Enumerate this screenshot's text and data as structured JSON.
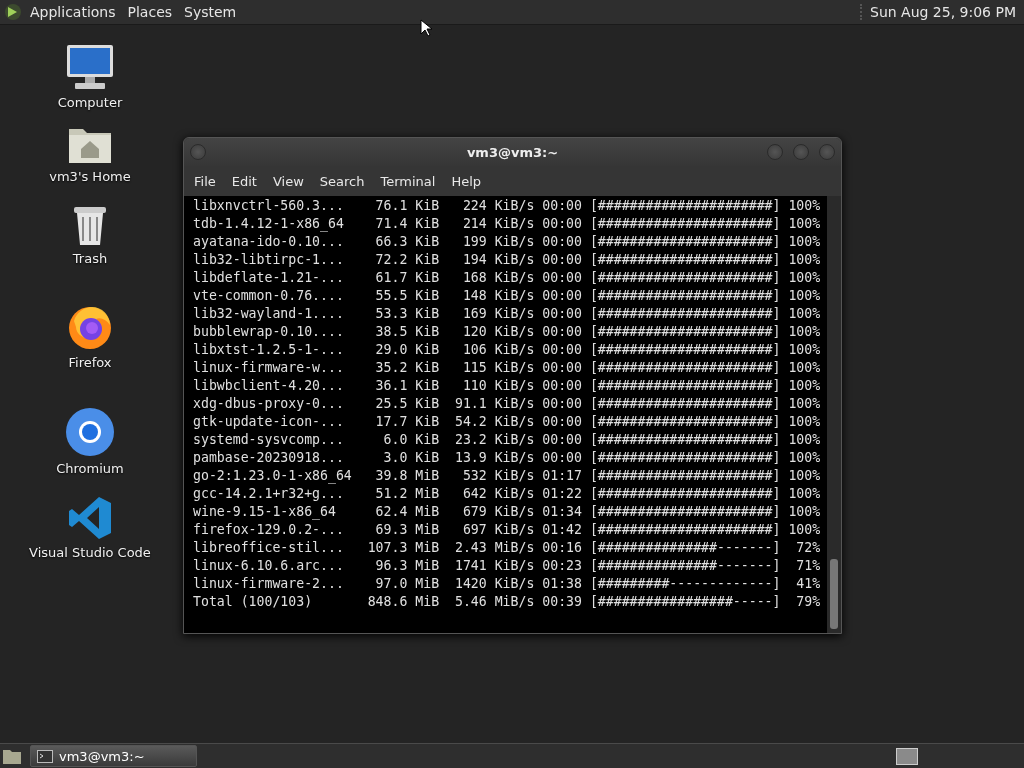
{
  "top_panel": {
    "menus": [
      {
        "label": "Applications"
      },
      {
        "label": "Places"
      },
      {
        "label": "System"
      }
    ],
    "clock": "Sun Aug 25,  9:06 PM"
  },
  "desktop_icons": [
    {
      "kind": "computer",
      "label": "Computer"
    },
    {
      "kind": "home",
      "label": "vm3's Home"
    },
    {
      "kind": "trash",
      "label": "Trash"
    },
    {
      "kind": "firefox",
      "label": "Firefox"
    },
    {
      "kind": "chromium",
      "label": "Chromium"
    },
    {
      "kind": "vscode",
      "label": "Visual Studio Code"
    }
  ],
  "terminal_window": {
    "title": "vm3@vm3:~",
    "menu": [
      "File",
      "Edit",
      "View",
      "Search",
      "Terminal",
      "Help"
    ],
    "rows": [
      {
        "name": "libxnvctrl-560.3...",
        "size": "76.1 KiB",
        "speed": "224 KiB/s",
        "eta": "00:00",
        "bar": "[######################]",
        "percent": "100%"
      },
      {
        "name": "tdb-1.4.12-1-x86_64",
        "size": "71.4 KiB",
        "speed": "214 KiB/s",
        "eta": "00:00",
        "bar": "[######################]",
        "percent": "100%"
      },
      {
        "name": "ayatana-ido-0.10...",
        "size": "66.3 KiB",
        "speed": "199 KiB/s",
        "eta": "00:00",
        "bar": "[######################]",
        "percent": "100%"
      },
      {
        "name": "lib32-libtirpc-1...",
        "size": "72.2 KiB",
        "speed": "194 KiB/s",
        "eta": "00:00",
        "bar": "[######################]",
        "percent": "100%"
      },
      {
        "name": "libdeflate-1.21-...",
        "size": "61.7 KiB",
        "speed": "168 KiB/s",
        "eta": "00:00",
        "bar": "[######################]",
        "percent": "100%"
      },
      {
        "name": "vte-common-0.76....",
        "size": "55.5 KiB",
        "speed": "148 KiB/s",
        "eta": "00:00",
        "bar": "[######################]",
        "percent": "100%"
      },
      {
        "name": "lib32-wayland-1....",
        "size": "53.3 KiB",
        "speed": "169 KiB/s",
        "eta": "00:00",
        "bar": "[######################]",
        "percent": "100%"
      },
      {
        "name": "bubblewrap-0.10....",
        "size": "38.5 KiB",
        "speed": "120 KiB/s",
        "eta": "00:00",
        "bar": "[######################]",
        "percent": "100%"
      },
      {
        "name": "libxtst-1.2.5-1-...",
        "size": "29.0 KiB",
        "speed": "106 KiB/s",
        "eta": "00:00",
        "bar": "[######################]",
        "percent": "100%"
      },
      {
        "name": "linux-firmware-w...",
        "size": "35.2 KiB",
        "speed": "115 KiB/s",
        "eta": "00:00",
        "bar": "[######################]",
        "percent": "100%"
      },
      {
        "name": "libwbclient-4.20...",
        "size": "36.1 KiB",
        "speed": "110 KiB/s",
        "eta": "00:00",
        "bar": "[######################]",
        "percent": "100%"
      },
      {
        "name": "xdg-dbus-proxy-0...",
        "size": "25.5 KiB",
        "speed": "91.1 KiB/s",
        "eta": "00:00",
        "bar": "[######################]",
        "percent": "100%"
      },
      {
        "name": "gtk-update-icon-...",
        "size": "17.7 KiB",
        "speed": "54.2 KiB/s",
        "eta": "00:00",
        "bar": "[######################]",
        "percent": "100%"
      },
      {
        "name": "systemd-sysvcomp...",
        "size": "6.0 KiB",
        "speed": "23.2 KiB/s",
        "eta": "00:00",
        "bar": "[######################]",
        "percent": "100%"
      },
      {
        "name": "pambase-20230918...",
        "size": "3.0 KiB",
        "speed": "13.9 KiB/s",
        "eta": "00:00",
        "bar": "[######################]",
        "percent": "100%"
      },
      {
        "name": "go-2:1.23.0-1-x86_64",
        "size": "39.8 MiB",
        "speed": "532 KiB/s",
        "eta": "01:17",
        "bar": "[######################]",
        "percent": "100%"
      },
      {
        "name": "gcc-14.2.1+r32+g...",
        "size": "51.2 MiB",
        "speed": "642 KiB/s",
        "eta": "01:22",
        "bar": "[######################]",
        "percent": "100%"
      },
      {
        "name": "wine-9.15-1-x86_64",
        "size": "62.4 MiB",
        "speed": "679 KiB/s",
        "eta": "01:34",
        "bar": "[######################]",
        "percent": "100%"
      },
      {
        "name": "firefox-129.0.2-...",
        "size": "69.3 MiB",
        "speed": "697 KiB/s",
        "eta": "01:42",
        "bar": "[######################]",
        "percent": "100%"
      },
      {
        "name": "libreoffice-stil...",
        "size": "107.3 MiB",
        "speed": "2.43 MiB/s",
        "eta": "00:16",
        "bar": "[###############-------]",
        "percent": "72%"
      },
      {
        "name": "linux-6.10.6.arc...",
        "size": "96.3 MiB",
        "speed": "1741 KiB/s",
        "eta": "00:23",
        "bar": "[###############-------]",
        "percent": "71%"
      },
      {
        "name": "linux-firmware-2...",
        "size": "97.0 MiB",
        "speed": "1420 KiB/s",
        "eta": "01:38",
        "bar": "[#########-------------]",
        "percent": "41%"
      },
      {
        "name": "Total (100/103)",
        "size": "848.6 MiB",
        "speed": "5.46 MiB/s",
        "eta": "00:39",
        "bar": "[#################-----]",
        "percent": "79%"
      }
    ]
  },
  "taskbar": {
    "tasks": [
      {
        "label": "vm3@vm3:~",
        "selected": true
      }
    ]
  }
}
